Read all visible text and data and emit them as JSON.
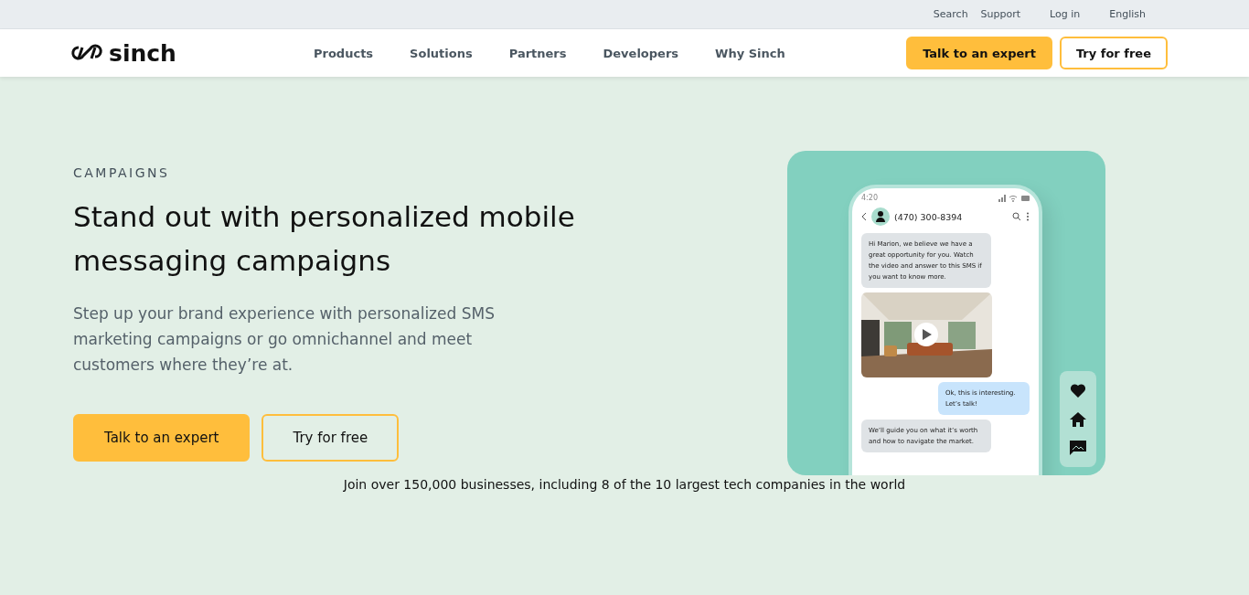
{
  "utility_bar": {
    "links": [
      "Search",
      "Support",
      "Log in",
      "English"
    ]
  },
  "nav": {
    "logo": "sinch",
    "items": [
      "Products",
      "Solutions",
      "Partners",
      "Developers",
      "Why Sinch"
    ],
    "buttons": [
      {
        "label": "Talk to an expert",
        "kind": "primary"
      },
      {
        "label": "Try for free",
        "kind": "outline"
      }
    ]
  },
  "hero": {
    "eyebrow": "CAMPAIGNS",
    "title": "Stand out with personalized mobile messaging campaigns",
    "description": "Step up your brand experience with personalized SMS marketing campaigns or go omnichannel and meet customers where they’re at.",
    "buttons": [
      {
        "label": "Talk to an expert",
        "kind": "primary"
      },
      {
        "label": "Try for free",
        "kind": "outline"
      }
    ]
  },
  "phone": {
    "time": "4:20",
    "contact": "(470) 300-8394",
    "messages": [
      {
        "kind": "incoming",
        "text": "Hi Marion, we believe we have a great opportunity for you. Watch the video and answer to this SMS if you want to know more."
      },
      {
        "kind": "video"
      },
      {
        "kind": "outgoing",
        "text": "Ok, this is interesting. Let’s talk!"
      },
      {
        "kind": "incoming",
        "text": "We’ll guide you on what it’s worth and how to navigate the market."
      }
    ]
  },
  "footer_note": "Join over 150,000 businesses, including 8 of the 10 largest tech companies in the world"
}
